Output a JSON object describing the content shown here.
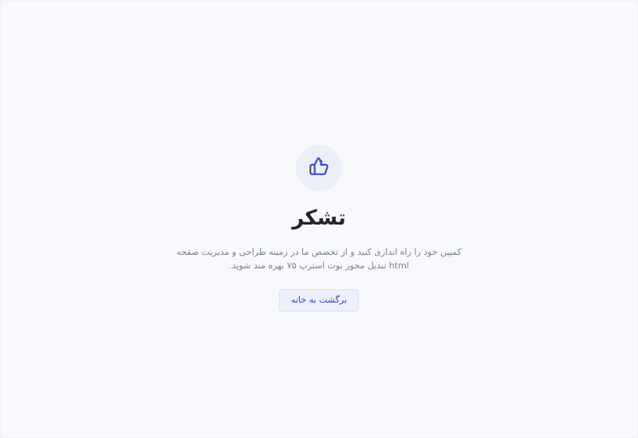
{
  "page": {
    "icon": "thumbs-up-icon",
    "accent_color": "#3446c6",
    "title": "تشکر",
    "description": "کمپین خود را راه اندازی کنید و از تخصص ما در زمینه طراحی و مدیریت صفحه html تبدیل محور بوت استرپ ۷۵ بهره مند شوید.",
    "button_label": "برگشت به خانه"
  }
}
